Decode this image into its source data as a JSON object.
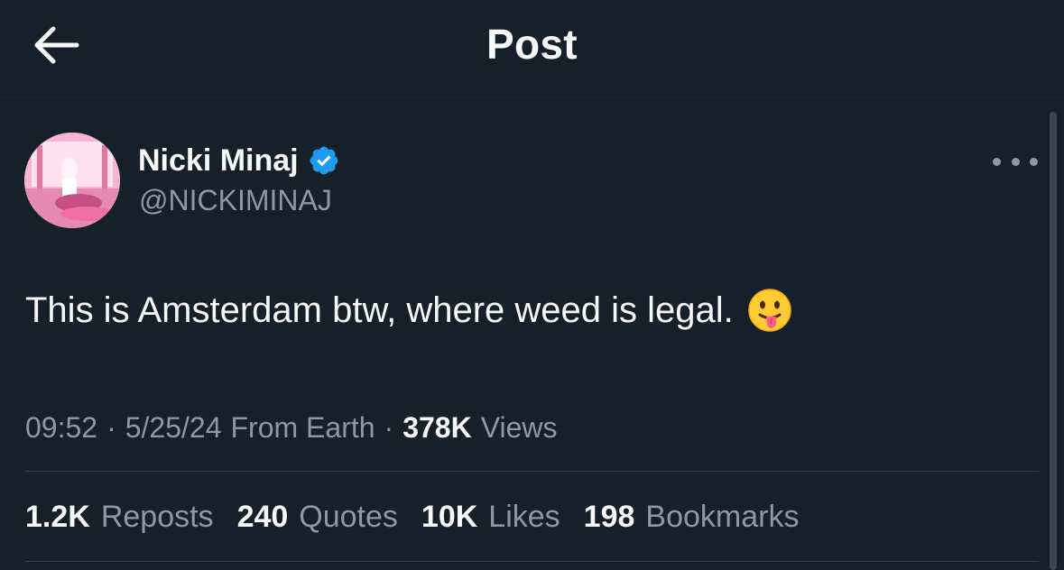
{
  "header": {
    "title": "Post",
    "back_icon": "arrow-left-icon"
  },
  "author": {
    "name": "Nicki Minaj",
    "handle": "@NICKIMINAJ",
    "verified_icon": "verified-badge-icon",
    "verified_color": "#1d9bf0"
  },
  "more_icon": "more-options-icon",
  "tweet": {
    "text": "This is Amsterdam btw, where weed is legal.",
    "emoji": "face-with-tongue-icon"
  },
  "meta": {
    "time": "09:52",
    "separator": "·",
    "date": "5/25/24",
    "source": "From Earth",
    "views_count": "378K",
    "views_label": "Views"
  },
  "stats": [
    {
      "count": "1.2K",
      "label": "Reposts"
    },
    {
      "count": "240",
      "label": "Quotes"
    },
    {
      "count": "10K",
      "label": "Likes"
    },
    {
      "count": "198",
      "label": "Bookmarks"
    }
  ],
  "colors": {
    "background": "#15202b",
    "text_primary": "#f7f9f9",
    "text_secondary": "#8b98a5",
    "accent": "#1d9bf0"
  }
}
